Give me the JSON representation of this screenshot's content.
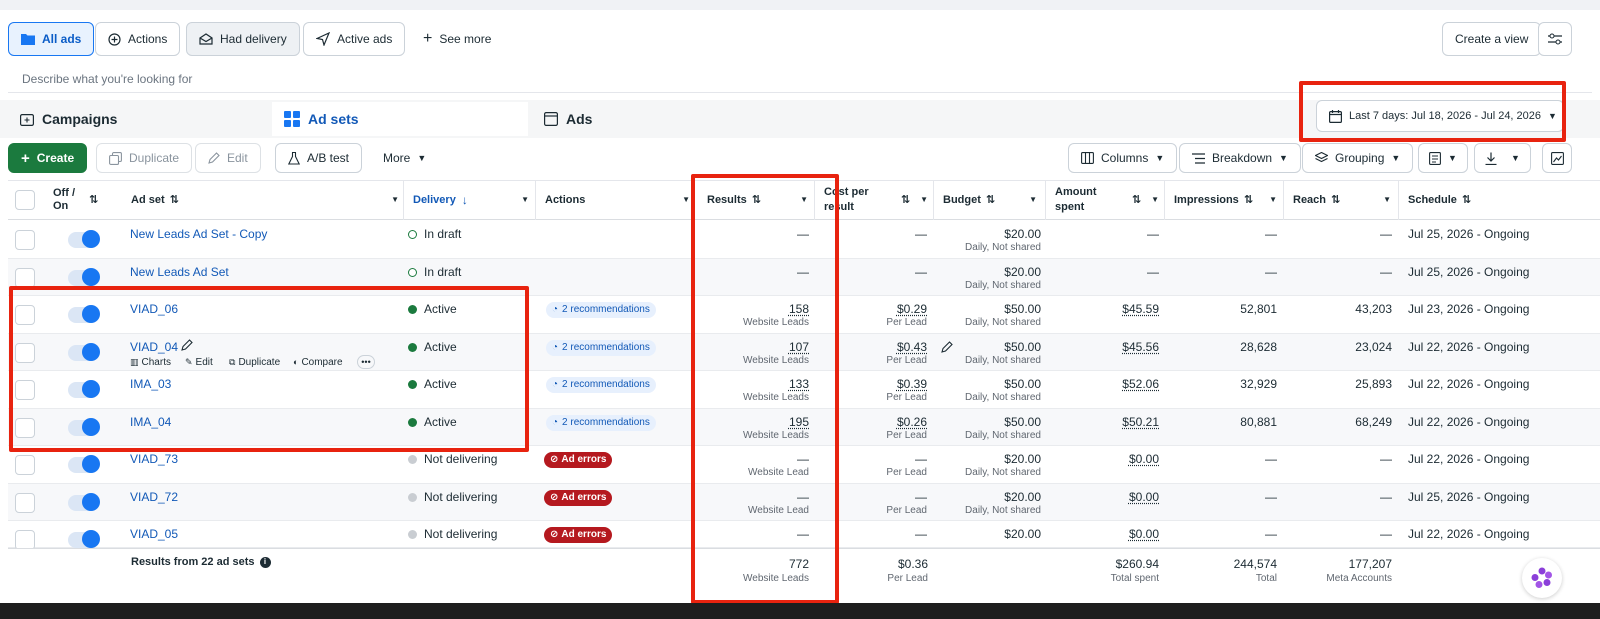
{
  "views": {
    "all_ads": "All ads",
    "actions": "Actions",
    "had_delivery": "Had delivery",
    "active_ads": "Active ads",
    "see_more": "See more",
    "create_view": "Create a view"
  },
  "search": {
    "placeholder": "Describe what you're looking for"
  },
  "tabs": {
    "campaigns": "Campaigns",
    "ad_sets": "Ad sets",
    "ads": "Ads"
  },
  "date_range": "Last 7 days: Jul 18, 2026 - Jul 24, 2026",
  "toolbar": {
    "create": "Create",
    "duplicate": "Duplicate",
    "edit": "Edit",
    "ab_test": "A/B test",
    "more": "More",
    "columns": "Columns",
    "breakdown": "Breakdown",
    "grouping": "Grouping"
  },
  "headers": {
    "off_on": "Off / On",
    "ad_set": "Ad set",
    "delivery": "Delivery",
    "actions": "Actions",
    "results": "Results",
    "cost_per_result_1": "Cost per",
    "cost_per_result_2": "result",
    "budget": "Budget",
    "amount_spent_1": "Amount",
    "amount_spent_2": "spent",
    "impressions": "Impressions",
    "reach": "Reach",
    "schedule": "Schedule"
  },
  "row_actions": {
    "charts": "Charts",
    "edit": "Edit",
    "duplicate": "Duplicate",
    "compare": "Compare"
  },
  "rows": [
    {
      "name": "New Leads Ad Set - Copy",
      "delivery": "In draft",
      "status": "draft",
      "action": "",
      "results": "—",
      "results_sub": "",
      "cpr": "—",
      "cpr_sub": "",
      "budget": "$20.00",
      "budget_sub": "Daily, Not shared",
      "spent": "—",
      "impressions": "—",
      "reach": "—",
      "schedule": "Jul 25, 2026 - Ongoing"
    },
    {
      "name": "New Leads Ad Set",
      "delivery": "In draft",
      "status": "draft",
      "action": "",
      "results": "—",
      "results_sub": "",
      "cpr": "—",
      "cpr_sub": "",
      "budget": "$20.00",
      "budget_sub": "Daily, Not shared",
      "spent": "—",
      "impressions": "—",
      "reach": "—",
      "schedule": "Jul 25, 2026 - Ongoing"
    },
    {
      "name": "VIAD_06",
      "delivery": "Active",
      "status": "active",
      "action": "2 recommendations",
      "results": "158",
      "results_sub": "Website Leads",
      "cpr": "$0.29",
      "cpr_sub": "Per Lead",
      "budget": "$50.00",
      "budget_sub": "Daily, Not shared",
      "spent": "$45.59",
      "impressions": "52,801",
      "reach": "43,203",
      "schedule": "Jul 23, 2026 - Ongoing"
    },
    {
      "name": "VIAD_04",
      "delivery": "Active",
      "status": "active",
      "action": "2 recommendations",
      "results": "107",
      "results_sub": "Website Leads",
      "cpr": "$0.43",
      "cpr_sub": "Per Lead",
      "budget": "$50.00",
      "budget_sub": "Daily, Not shared",
      "spent": "$45.56",
      "impressions": "28,628",
      "reach": "23,024",
      "schedule": "Jul 22, 2026 - Ongoing"
    },
    {
      "name": "IMA_03",
      "delivery": "Active",
      "status": "active",
      "action": "2 recommendations",
      "results": "133",
      "results_sub": "Website Leads",
      "cpr": "$0.39",
      "cpr_sub": "Per Lead",
      "budget": "$50.00",
      "budget_sub": "Daily, Not shared",
      "spent": "$52.06",
      "impressions": "32,929",
      "reach": "25,893",
      "schedule": "Jul 22, 2026 - Ongoing"
    },
    {
      "name": "IMA_04",
      "delivery": "Active",
      "status": "active",
      "action": "2 recommendations",
      "results": "195",
      "results_sub": "Website Leads",
      "cpr": "$0.26",
      "cpr_sub": "Per Lead",
      "budget": "$50.00",
      "budget_sub": "Daily, Not shared",
      "spent": "$50.21",
      "impressions": "80,881",
      "reach": "68,249",
      "schedule": "Jul 22, 2026 - Ongoing"
    },
    {
      "name": "VIAD_73",
      "delivery": "Not delivering",
      "status": "off",
      "action": "Ad errors",
      "results": "—",
      "results_sub": "Website Lead",
      "cpr": "—",
      "cpr_sub": "Per Lead",
      "budget": "$20.00",
      "budget_sub": "Daily, Not shared",
      "spent": "$0.00",
      "impressions": "—",
      "reach": "—",
      "schedule": "Jul 22, 2026 - Ongoing"
    },
    {
      "name": "VIAD_72",
      "delivery": "Not delivering",
      "status": "off",
      "action": "Ad errors",
      "results": "—",
      "results_sub": "Website Lead",
      "cpr": "—",
      "cpr_sub": "Per Lead",
      "budget": "$20.00",
      "budget_sub": "Daily, Not shared",
      "spent": "$0.00",
      "impressions": "—",
      "reach": "—",
      "schedule": "Jul 25, 2026 - Ongoing"
    },
    {
      "name": "VIAD_05",
      "delivery": "Not delivering",
      "status": "off",
      "action": "Ad errors",
      "results": "—",
      "results_sub": "",
      "cpr": "—",
      "cpr_sub": "",
      "budget": "$20.00",
      "budget_sub": "",
      "spent": "$0.00",
      "impressions": "—",
      "reach": "—",
      "schedule": "Jul 22, 2026 - Ongoing"
    }
  ],
  "summary": {
    "label": "Results from 22 ad sets",
    "results": "772",
    "results_sub": "Website Leads",
    "cpr": "$0.36",
    "cpr_sub": "Per Lead",
    "spent": "$260.94",
    "spent_sub": "Total spent",
    "impressions": "244,574",
    "impressions_sub": "Total",
    "reach": "177,207",
    "reach_sub": "Meta Accounts"
  },
  "colors": {
    "highlight": "#e8230f",
    "link": "#1259b7",
    "active": "#1b7a3e",
    "error": "#b5191f"
  }
}
